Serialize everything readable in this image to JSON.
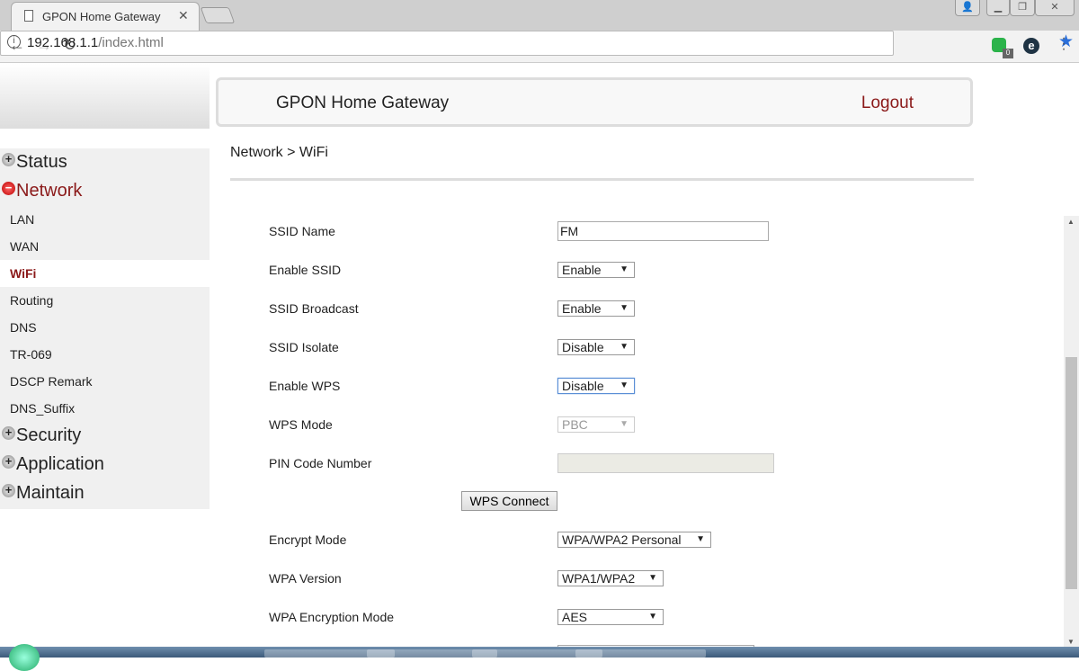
{
  "browser": {
    "tab_title": "GPON Home Gateway",
    "url_host": "192.168.1.1",
    "url_path": "/index.html",
    "ext_badge": "0"
  },
  "header": {
    "title": "GPON Home Gateway",
    "logout": "Logout"
  },
  "breadcrumb": "Network > WiFi",
  "sidebar": {
    "status": "Status",
    "network": "Network",
    "network_items": [
      "LAN",
      "WAN",
      "WiFi",
      "Routing",
      "DNS",
      "TR-069",
      "DSCP Remark",
      "DNS_Suffix"
    ],
    "security": "Security",
    "application": "Application",
    "maintain": "Maintain"
  },
  "form": {
    "ssid_name": {
      "label": "SSID Name",
      "value": "FM"
    },
    "enable_ssid": {
      "label": "Enable SSID",
      "value": "Enable"
    },
    "ssid_broadcast": {
      "label": "SSID Broadcast",
      "value": "Enable"
    },
    "ssid_isolate": {
      "label": "SSID Isolate",
      "value": "Disable"
    },
    "enable_wps": {
      "label": "Enable WPS",
      "value": "Disable"
    },
    "wps_mode": {
      "label": "WPS Mode",
      "value": "PBC"
    },
    "pin_code": {
      "label": "PIN Code Number",
      "value": ""
    },
    "wps_connect": "WPS Connect",
    "encrypt_mode": {
      "label": "Encrypt Mode",
      "value": "WPA/WPA2 Personal"
    },
    "wpa_version": {
      "label": "WPA Version",
      "value": "WPA1/WPA2"
    },
    "wpa_encryption": {
      "label": "WPA Encryption Mode",
      "value": "AES"
    }
  }
}
